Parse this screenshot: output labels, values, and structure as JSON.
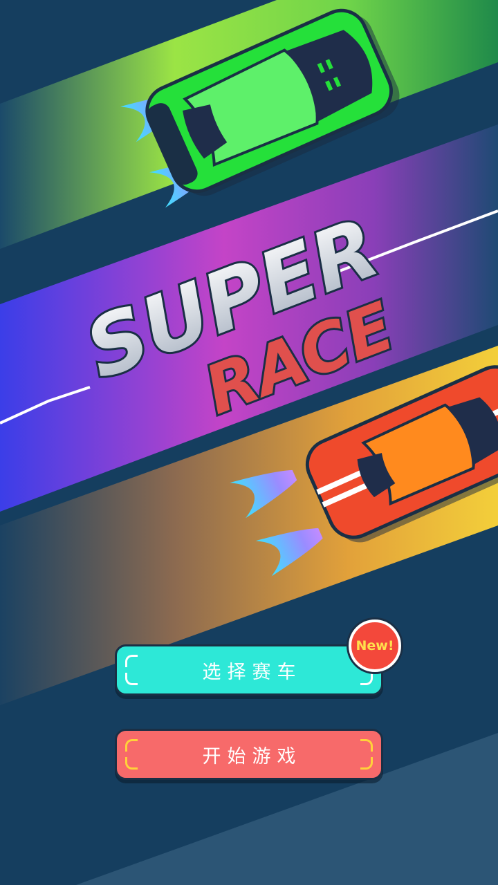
{
  "logo": {
    "line1": "SUPER",
    "line2": "RACE"
  },
  "menu": {
    "select_car_label": "选择赛车",
    "start_game_label": "开始游戏",
    "new_badge": "New!"
  },
  "colors": {
    "background": "#153e5f",
    "select_button": "#2de8d7",
    "start_button": "#f76a6a",
    "badge": "#f3483b",
    "badge_text": "#ffe14d",
    "logo_red": "#e0504d"
  },
  "icons": [
    "green-race-car-icon",
    "orange-race-car-icon",
    "flame-icon"
  ]
}
